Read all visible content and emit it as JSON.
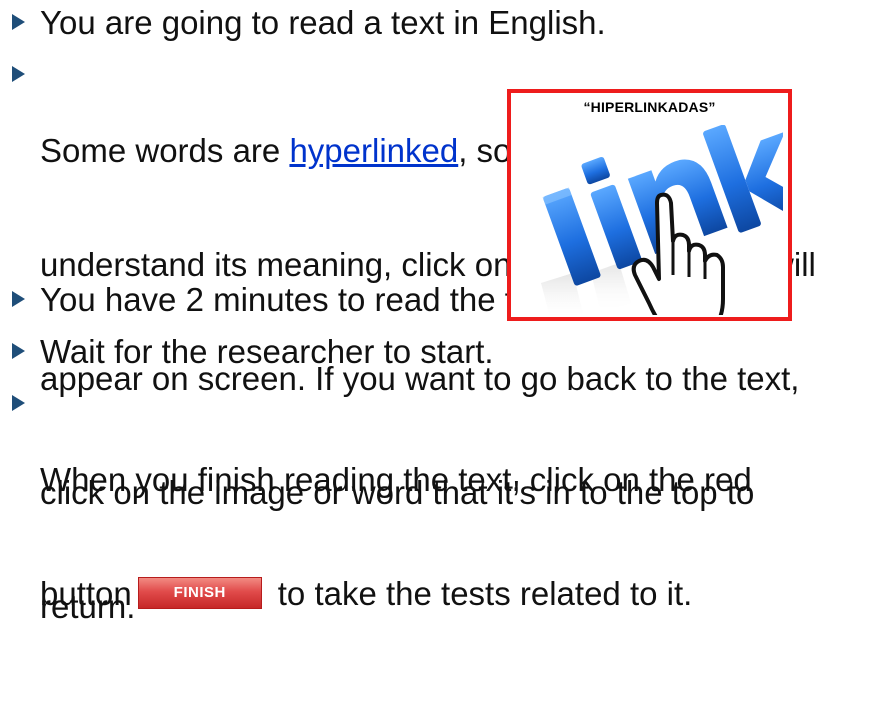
{
  "slide": {
    "bullets": [
      {
        "text": "You are going to read a text in English."
      },
      {
        "lines": [
          {
            "before": "Some words are ",
            "link": "hyperlinked",
            "after": ", so, if you don’t"
          },
          {
            "text": "understand its meaning, click on it and a glossary will"
          },
          {
            "text": "appear on screen. If you want to go back to the text,"
          },
          {
            "text": "click on the image or word that it's in to the top to"
          },
          {
            "text": "return."
          }
        ]
      },
      {
        "text": "You have 2 minutes to read the text."
      },
      {
        "text": "Wait for the researcher to start."
      },
      {
        "lines": [
          {
            "text": "When you finish reading the text, click on the red"
          },
          {
            "before": "button",
            "button_label": "FINISH",
            "after": "to take the tests related to it."
          }
        ]
      }
    ],
    "popup": {
      "title": "“HIPERLINKADAS”",
      "image_icon": "link-hand-cursor-icon",
      "border_color": "#ee1c1c"
    },
    "colors": {
      "bullet_marker": "#1f4e79",
      "hyperlink": "#0033cc",
      "finish_button": "#e14b4b"
    }
  }
}
